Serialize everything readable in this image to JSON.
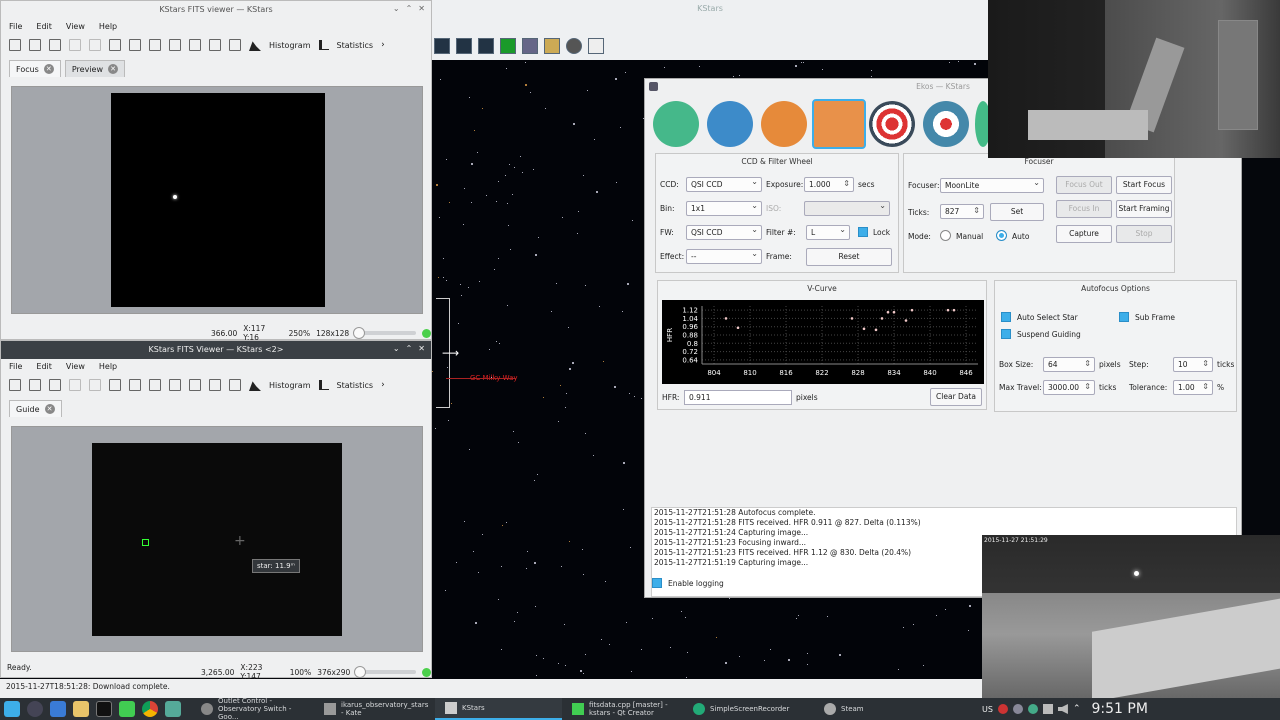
{
  "kstars": {
    "title": "KStars",
    "grid_label": "GC Milky Way"
  },
  "fits_focus": {
    "title": "KStars FITS viewer — KStars",
    "menu": [
      "File",
      "Edit",
      "View",
      "Help"
    ],
    "toolbar": {
      "histogram": "Histogram",
      "statistics": "Statistics"
    },
    "tabs": [
      {
        "label": "Focus"
      },
      {
        "label": "Preview"
      }
    ],
    "status": {
      "value": "366.00",
      "coords": "X:117 Y:16",
      "zoom": "250%",
      "size": "128x128"
    }
  },
  "fits_guide": {
    "title": "KStars FITS Viewer — KStars <2>",
    "menu": [
      "File",
      "Edit",
      "View",
      "Help"
    ],
    "toolbar": {
      "histogram": "Histogram",
      "statistics": "Statistics"
    },
    "tabs": [
      {
        "label": "Guide"
      }
    ],
    "tooltip": "star: 11.9ᵐ",
    "ready": "Ready.",
    "status": {
      "value": "3,265.00",
      "coords": "X:223 Y:147",
      "zoom": "100%",
      "size": "376x290"
    },
    "last_status": "2015-11-27T18:51:28: Download complete."
  },
  "ekos": {
    "title": "Ekos — KStars",
    "ccd": {
      "group_title": "CCD & Filter Wheel",
      "ccd_label": "CCD:",
      "ccd_value": "QSI CCD",
      "exposure_label": "Exposure:",
      "exposure_value": "1.000",
      "exposure_unit": "secs",
      "bin_label": "Bin:",
      "bin_value": "1x1",
      "iso_label": "ISO:",
      "fw_label": "FW:",
      "fw_value": "QSI CCD",
      "filter_label": "Filter #:",
      "filter_value": "L",
      "lock_label": "Lock",
      "effect_label": "Effect:",
      "effect_value": "--",
      "frame_label": "Frame:",
      "reset_label": "Reset"
    },
    "focuser": {
      "group_title": "Focuser",
      "focuser_label": "Focuser:",
      "focuser_value": "MoonLite",
      "ticks_label": "Ticks:",
      "ticks_value": "827",
      "set_label": "Set",
      "mode_label": "Mode:",
      "manual_label": "Manual",
      "auto_label": "Auto",
      "focus_out": "Focus Out",
      "start_focus": "Start Focus",
      "focus_in": "Focus In",
      "start_framing": "Start Framing",
      "capture": "Capture",
      "stop": "Stop"
    },
    "vcurve": {
      "group_title": "V-Curve",
      "hfr_label": "HFR:",
      "hfr_value": "0.911",
      "hfr_unit": "pixels",
      "clear_label": "Clear Data"
    },
    "af_options": {
      "group_title": "Autofocus Options",
      "auto_select_star": "Auto Select Star",
      "sub_frame": "Sub Frame",
      "suspend_guiding": "Suspend Guiding",
      "box_size_label": "Box Size:",
      "box_size_value": "64",
      "box_size_unit": "pixels",
      "step_label": "Step:",
      "step_value": "10",
      "step_unit": "ticks",
      "max_travel_label": "Max Travel:",
      "max_travel_value": "3000.00",
      "max_travel_unit": "ticks",
      "tolerance_label": "Tolerance:",
      "tolerance_value": "1.00",
      "tolerance_unit": "%"
    },
    "log": [
      "2015-11-27T21:51:28 Autofocus complete.",
      "2015-11-27T21:51:28 FITS received. HFR 0.911 @ 827. Delta (0.113%)",
      "2015-11-27T21:51:24 Capturing image...",
      "2015-11-27T21:51:23 Focusing inward...",
      "2015-11-27T21:51:23 FITS received. HFR 1.12 @ 830. Delta (20.4%)",
      "2015-11-27T21:51:19 Capturing image..."
    ],
    "enable_logging": "Enable logging"
  },
  "chart_data": {
    "type": "scatter",
    "xlabel": "",
    "ylabel": "HFR",
    "xlim": [
      802,
      848
    ],
    "ylim": [
      0.6,
      1.16
    ],
    "x_ticks": [
      "804",
      "810",
      "816",
      "822",
      "828",
      "834",
      "840",
      "846"
    ],
    "y_ticks": [
      "1.12",
      "1.04",
      "0.96",
      "0.88",
      "0.8",
      "0.72",
      "0.64"
    ],
    "grid": true,
    "series": [
      {
        "x": [
          806,
          808,
          827,
          829,
          831,
          832,
          833,
          834,
          836,
          837,
          843,
          844
        ],
        "y": [
          1.04,
          0.95,
          1.04,
          0.94,
          0.93,
          1.04,
          1.1,
          1.1,
          1.02,
          1.12,
          1.12,
          1.12
        ]
      }
    ]
  },
  "webcams": [
    {
      "timestamp": "2015-11-27 21:51:29"
    }
  ],
  "taskbar": {
    "tasks": [
      "Outlet Control - Observatory Switch - Goo...",
      "ikarus_observatory_stars - Kate",
      "KStars",
      "fitsdata.cpp [master] - kstars - Qt Creator",
      "SimpleScreenRecorder",
      "Steam"
    ],
    "keyboard": "US",
    "clock": "9:51 PM"
  }
}
